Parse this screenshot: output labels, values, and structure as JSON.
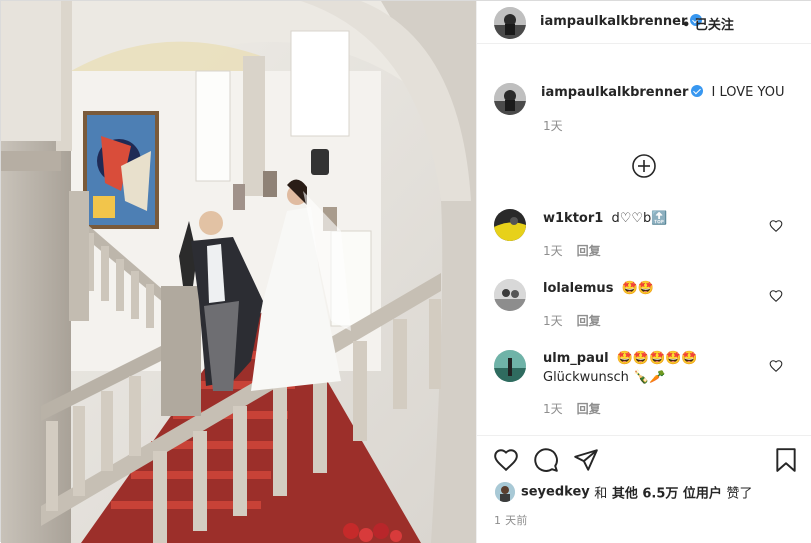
{
  "post": {
    "author": "iampaulkalkbrenner",
    "follow_state": "已关注",
    "header_separator": "•"
  },
  "caption": {
    "username": "iampaulkalkbrenner",
    "text": "I LOVE YOU",
    "time": "1天"
  },
  "load_more_icon": "plus-circle-icon",
  "comments": [
    {
      "username": "w1ktor1",
      "text": "d♡♡b🔝",
      "time": "1天",
      "reply": "回复"
    },
    {
      "username": "lolalemus",
      "text": "🤩🤩",
      "time": "1天",
      "reply": "回复"
    },
    {
      "username": "ulm_paul",
      "text": "🤩🤩🤩🤩🤩",
      "text2": "Glückwunsch 🍾🥕",
      "time": "1天",
      "reply": "回复"
    }
  ],
  "actions": {
    "icons": [
      "heart-icon",
      "comment-icon",
      "share-icon",
      "bookmark-icon"
    ]
  },
  "likes": {
    "liker": "seyedkey",
    "and": "和",
    "others": "其他 6.5万 位用户",
    "suffix": "赞了"
  },
  "posted": "1 天前",
  "colors": {
    "verified": "#3897f0",
    "text_primary": "#262626",
    "text_secondary": "#8e8e8e",
    "divider": "#efefef"
  }
}
